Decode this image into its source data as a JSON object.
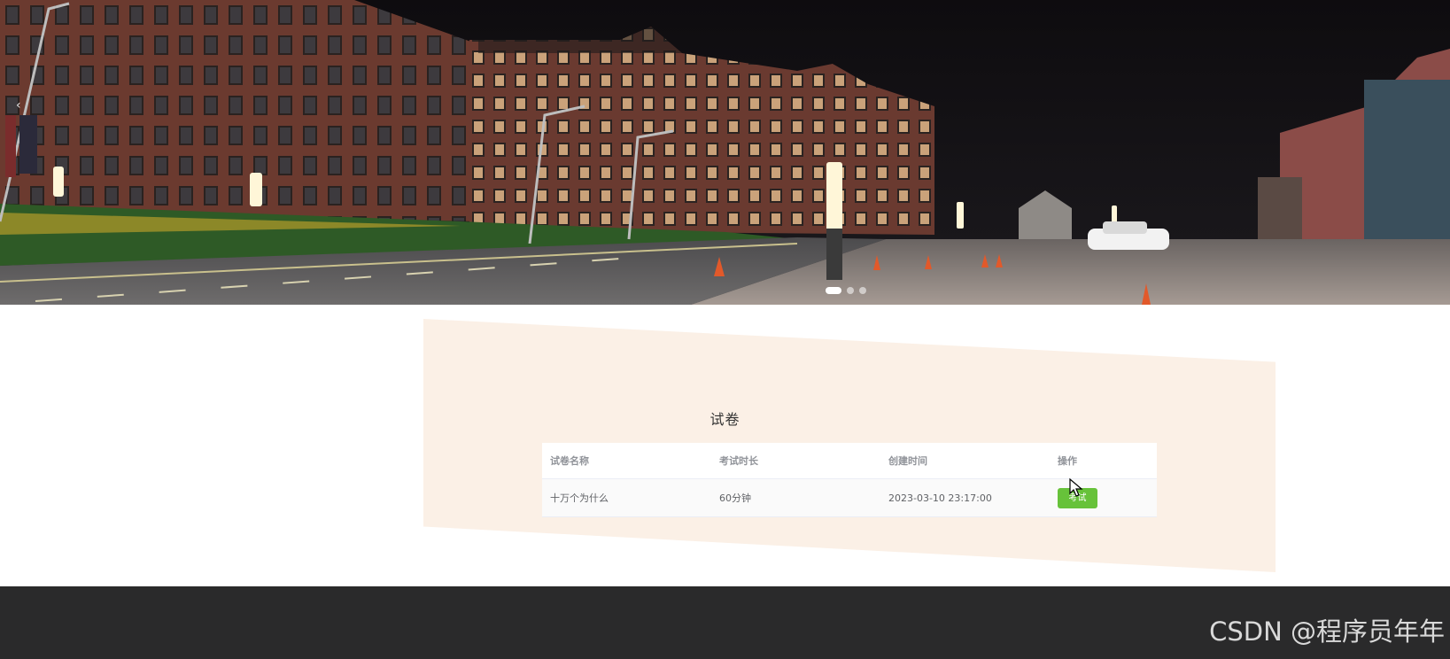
{
  "banner": {
    "prev_arrow": "‹",
    "slide_count": 3,
    "active_slide": 1
  },
  "section": {
    "title": "试卷"
  },
  "table": {
    "headers": {
      "name": "试卷名称",
      "duration": "考试时长",
      "created": "创建时间",
      "action": "操作"
    },
    "rows": [
      {
        "name": "十万个为什么",
        "duration": "60分钟",
        "created": "2023-03-10 23:17:00",
        "action_label": "考试"
      }
    ]
  },
  "footer": {
    "watermark": "CSDN @程序员年年"
  },
  "colors": {
    "button": "#67c23a",
    "paper_bg": "#fbf0e6",
    "footer": "#2a2a2b"
  }
}
